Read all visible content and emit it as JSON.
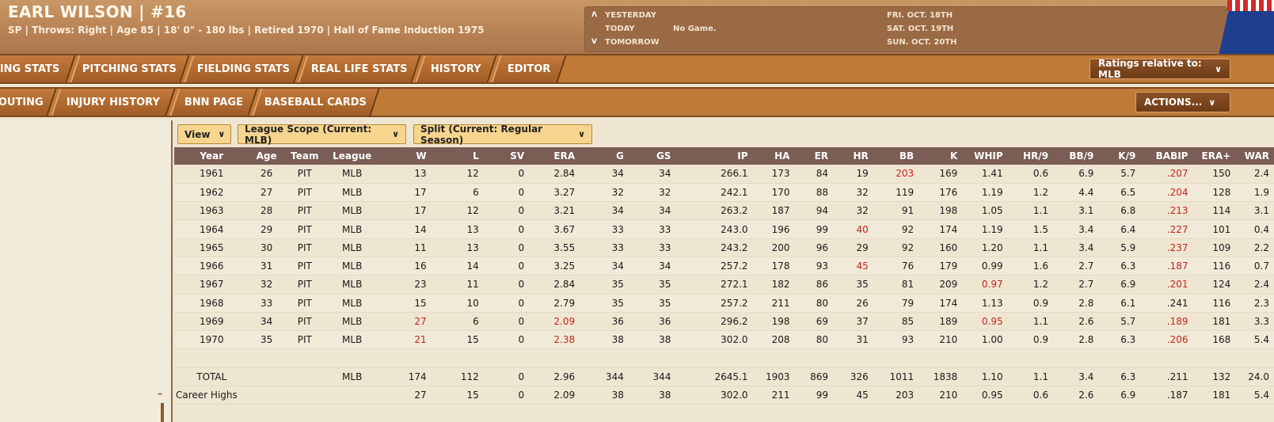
{
  "player": {
    "name": "EARL WILSON  |  #16",
    "info": "SP | Throws: Right  |  Age 85  |  18' 0\" - 180 lbs  |  Retired 1970  |  Hall of Fame Induction 1975"
  },
  "schedule": {
    "yesterday_label": "YESTERDAY",
    "today_label": "TODAY",
    "tomorrow_label": "TOMORROW",
    "today_game": "No Game.",
    "dates": [
      "FRI. OCT. 18TH",
      "SAT. OCT. 19TH",
      "SUN. OCT. 20TH"
    ]
  },
  "tabs_row1": [
    "ING STATS",
    "PITCHING STATS",
    "FIELDING STATS",
    "REAL LIFE STATS",
    "HISTORY",
    "EDITOR"
  ],
  "tabs_row2": [
    "OUTING",
    "INJURY HISTORY",
    "BNN PAGE",
    "BASEBALL CARDS"
  ],
  "ratings_button": "Ratings relative to: MLB",
  "actions_button": "ACTIONS...",
  "filters": {
    "view": "View",
    "league_scope": "League Scope  (Current: MLB)",
    "split": "Split  (Current: Regular Season)"
  },
  "table": {
    "headers": [
      "Year",
      "Age",
      "Team",
      "League",
      "W",
      "L",
      "SV",
      "ERA",
      "G",
      "GS",
      "IP",
      "HA",
      "ER",
      "HR",
      "BB",
      "K",
      "WHIP",
      "HR/9",
      "BB/9",
      "K/9",
      "BABIP",
      "ERA+",
      "WAR"
    ],
    "rows": [
      [
        "1961",
        "26",
        "PIT",
        "MLB",
        "13",
        "12",
        "0",
        "2.84",
        "34",
        "34",
        "266.1",
        "173",
        "84",
        "19",
        "203",
        "169",
        "1.41",
        "0.6",
        "6.9",
        "5.7",
        ".207",
        "150",
        "2.4"
      ],
      [
        "1962",
        "27",
        "PIT",
        "MLB",
        "17",
        "6",
        "0",
        "3.27",
        "32",
        "32",
        "242.1",
        "170",
        "88",
        "32",
        "119",
        "176",
        "1.19",
        "1.2",
        "4.4",
        "6.5",
        ".204",
        "128",
        "1.9"
      ],
      [
        "1963",
        "28",
        "PIT",
        "MLB",
        "17",
        "12",
        "0",
        "3.21",
        "34",
        "34",
        "263.2",
        "187",
        "94",
        "32",
        "91",
        "198",
        "1.05",
        "1.1",
        "3.1",
        "6.8",
        ".213",
        "114",
        "3.1"
      ],
      [
        "1964",
        "29",
        "PIT",
        "MLB",
        "14",
        "13",
        "0",
        "3.67",
        "33",
        "33",
        "243.0",
        "196",
        "99",
        "40",
        "92",
        "174",
        "1.19",
        "1.5",
        "3.4",
        "6.4",
        ".227",
        "101",
        "0.4"
      ],
      [
        "1965",
        "30",
        "PIT",
        "MLB",
        "11",
        "13",
        "0",
        "3.55",
        "33",
        "33",
        "243.2",
        "200",
        "96",
        "29",
        "92",
        "160",
        "1.20",
        "1.1",
        "3.4",
        "5.9",
        ".237",
        "109",
        "2.2"
      ],
      [
        "1966",
        "31",
        "PIT",
        "MLB",
        "16",
        "14",
        "0",
        "3.25",
        "34",
        "34",
        "257.2",
        "178",
        "93",
        "45",
        "76",
        "179",
        "0.99",
        "1.6",
        "2.7",
        "6.3",
        ".187",
        "116",
        "0.7"
      ],
      [
        "1967",
        "32",
        "PIT",
        "MLB",
        "23",
        "11",
        "0",
        "2.84",
        "35",
        "35",
        "272.1",
        "182",
        "86",
        "35",
        "81",
        "209",
        "0.97",
        "1.2",
        "2.7",
        "6.9",
        ".201",
        "124",
        "2.4"
      ],
      [
        "1968",
        "33",
        "PIT",
        "MLB",
        "15",
        "10",
        "0",
        "2.79",
        "35",
        "35",
        "257.2",
        "211",
        "80",
        "26",
        "79",
        "174",
        "1.13",
        "0.9",
        "2.8",
        "6.1",
        ".241",
        "116",
        "2.3"
      ],
      [
        "1969",
        "34",
        "PIT",
        "MLB",
        "27",
        "6",
        "0",
        "2.09",
        "36",
        "36",
        "296.2",
        "198",
        "69",
        "37",
        "85",
        "189",
        "0.95",
        "1.1",
        "2.6",
        "5.7",
        ".189",
        "181",
        "3.3"
      ],
      [
        "1970",
        "35",
        "PIT",
        "MLB",
        "21",
        "15",
        "0",
        "2.38",
        "38",
        "38",
        "302.0",
        "208",
        "80",
        "31",
        "93",
        "210",
        "1.00",
        "0.9",
        "2.8",
        "6.3",
        ".206",
        "168",
        "5.4"
      ]
    ],
    "highlights": [
      [
        0,
        14
      ],
      [
        0,
        20
      ],
      [
        1,
        20
      ],
      [
        2,
        20
      ],
      [
        3,
        13
      ],
      [
        3,
        20
      ],
      [
        4,
        20
      ],
      [
        5,
        13
      ],
      [
        5,
        20
      ],
      [
        6,
        16
      ],
      [
        6,
        20
      ],
      [
        8,
        4
      ],
      [
        8,
        7
      ],
      [
        8,
        16
      ],
      [
        8,
        20
      ],
      [
        9,
        4
      ],
      [
        9,
        7
      ],
      [
        9,
        20
      ]
    ],
    "total": [
      "TOTAL",
      "",
      "",
      "MLB",
      "174",
      "112",
      "0",
      "2.96",
      "344",
      "344",
      "2645.1",
      "1903",
      "869",
      "326",
      "1011",
      "1838",
      "1.10",
      "1.1",
      "3.4",
      "6.3",
      ".211",
      "132",
      "24.0"
    ],
    "career_highs": [
      "Career Highs",
      "",
      "",
      "",
      "27",
      "15",
      "0",
      "2.09",
      "38",
      "38",
      "302.0",
      "211",
      "99",
      "45",
      "203",
      "210",
      "0.95",
      "0.6",
      "2.6",
      "6.9",
      ".187",
      "181",
      "5.4"
    ]
  }
}
